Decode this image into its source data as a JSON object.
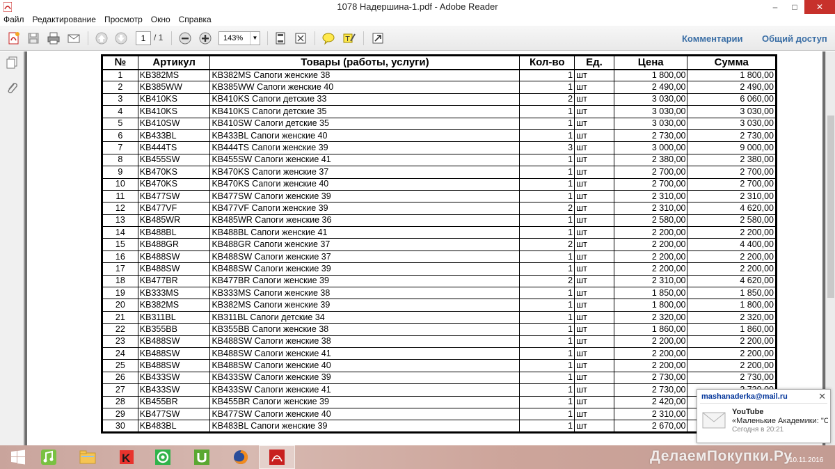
{
  "window": {
    "title": "1078 Надершина-1.pdf - Adobe Reader",
    "minimize": "–",
    "maximize": "□",
    "close": "✕"
  },
  "menu": [
    "Файл",
    "Редактирование",
    "Просмотр",
    "Окно",
    "Справка"
  ],
  "toolbar": {
    "page_current": "1",
    "page_total": "/ 1",
    "zoom": "143%",
    "comments_label": "Комментарии",
    "share_label": "Общий доступ"
  },
  "table": {
    "headers": [
      "№",
      "Артикул",
      "Товары (работы, услуги)",
      "Кол-во",
      "Ед.",
      "Цена",
      "Сумма"
    ],
    "rows": [
      [
        "1",
        "KB382MS",
        "KB382MS Сапоги женские 38",
        "1",
        "шт",
        "1 800,00",
        "1 800,00"
      ],
      [
        "2",
        "KB385WW",
        "KB385WW Сапоги женские 40",
        "1",
        "шт",
        "2 490,00",
        "2 490,00"
      ],
      [
        "3",
        "KB410KS",
        "KB410KS Сапоги детские 33",
        "2",
        "шт",
        "3 030,00",
        "6 060,00"
      ],
      [
        "4",
        "KB410KS",
        "KB410KS Сапоги детские 35",
        "1",
        "шт",
        "3 030,00",
        "3 030,00"
      ],
      [
        "5",
        "KB410SW",
        "KB410SW Сапоги детские 35",
        "1",
        "шт",
        "3 030,00",
        "3 030,00"
      ],
      [
        "6",
        "KB433BL",
        "KB433BL Сапоги женские 40",
        "1",
        "шт",
        "2 730,00",
        "2 730,00"
      ],
      [
        "7",
        "KB444TS",
        "KB444TS Сапоги женские 39",
        "3",
        "шт",
        "3 000,00",
        "9 000,00"
      ],
      [
        "8",
        "KB455SW",
        "KB455SW Сапоги женские 41",
        "1",
        "шт",
        "2 380,00",
        "2 380,00"
      ],
      [
        "9",
        "KB470KS",
        "KB470KS Сапоги женские 37",
        "1",
        "шт",
        "2 700,00",
        "2 700,00"
      ],
      [
        "10",
        "KB470KS",
        "KB470KS Сапоги женские 40",
        "1",
        "шт",
        "2 700,00",
        "2 700,00"
      ],
      [
        "11",
        "KB477SW",
        "KB477SW Сапоги женские 39",
        "1",
        "шт",
        "2 310,00",
        "2 310,00"
      ],
      [
        "12",
        "KB477VF",
        "KB477VF Сапоги женские 39",
        "2",
        "шт",
        "2 310,00",
        "4 620,00"
      ],
      [
        "13",
        "KB485WR",
        "KB485WR  Сапоги женские 36",
        "1",
        "шт",
        "2 580,00",
        "2 580,00"
      ],
      [
        "14",
        "KB488BL",
        "KB488BL Сапоги женские 41",
        "1",
        "шт",
        "2 200,00",
        "2 200,00"
      ],
      [
        "15",
        "KB488GR",
        "KB488GR Сапоги женские 37",
        "2",
        "шт",
        "2 200,00",
        "4 400,00"
      ],
      [
        "16",
        "KB488SW",
        "KB488SW Сапоги женские 37",
        "1",
        "шт",
        "2 200,00",
        "2 200,00"
      ],
      [
        "17",
        "KB488SW",
        "KB488SW Сапоги женские 39",
        "1",
        "шт",
        "2 200,00",
        "2 200,00"
      ],
      [
        "18",
        "KB477BR",
        "KB477BR Сапоги женские 39",
        "2",
        "шт",
        "2 310,00",
        "4 620,00"
      ],
      [
        "19",
        "KB333MS",
        "KB333MS Сапоги женские 38",
        "1",
        "шт",
        "1 850,00",
        "1 850,00"
      ],
      [
        "20",
        "KB382MS",
        "KB382MS Сапоги женские 39",
        "1",
        "шт",
        "1 800,00",
        "1 800,00"
      ],
      [
        "21",
        "KB311BL",
        "KB311BL Сапоги детские 34",
        "1",
        "шт",
        "2 320,00",
        "2 320,00"
      ],
      [
        "22",
        "KB355BB",
        "KB355BB Сапоги женские 38",
        "1",
        "шт",
        "1 860,00",
        "1 860,00"
      ],
      [
        "23",
        "KB488SW",
        "KB488SW Сапоги женские 38",
        "1",
        "шт",
        "2 200,00",
        "2 200,00"
      ],
      [
        "24",
        "KB488SW",
        "KB488SW Сапоги женские 41",
        "1",
        "шт",
        "2 200,00",
        "2 200,00"
      ],
      [
        "25",
        "KB488SW",
        "KB488SW Сапоги женские 40",
        "1",
        "шт",
        "2 200,00",
        "2 200,00"
      ],
      [
        "26",
        "KB433SW",
        "KB433SW Сапоги женские 39",
        "1",
        "шт",
        "2 730,00",
        "2 730,00"
      ],
      [
        "27",
        "KB433SW",
        "KB433SW Сапоги женские 41",
        "1",
        "шт",
        "2 730,00",
        "2 730,00"
      ],
      [
        "28",
        "KB455BR",
        "KB455BR Сапоги женские 39",
        "1",
        "шт",
        "2 420,00",
        "2 420,00"
      ],
      [
        "29",
        "KB477SW",
        "KB477SW Сапоги женские 40",
        "1",
        "шт",
        "2 310,00",
        "2 310,00"
      ],
      [
        "30",
        "KB483BL",
        "KB483BL Сапоги женские 39",
        "1",
        "шт",
        "2 670,00",
        "2 670,00"
      ]
    ]
  },
  "notification": {
    "account": "mashanaderka@mail.ru",
    "from": "YouTube",
    "subject": "«Маленькие Академики: \"Св...",
    "time": "Сегодня в 20:21"
  },
  "taskbar": {
    "apps": [
      "windows-start",
      "winamp",
      "file-explorer",
      "kaspersky",
      "icq",
      "utorrent",
      "firefox",
      "adobe-reader"
    ],
    "watermark": "ДелаемПокупки.Ру",
    "date": "10.11.2016"
  },
  "colors": {
    "accent_link": "#3a6ea5",
    "close_red": "#c7312b",
    "pdf_red": "#c8201f"
  }
}
